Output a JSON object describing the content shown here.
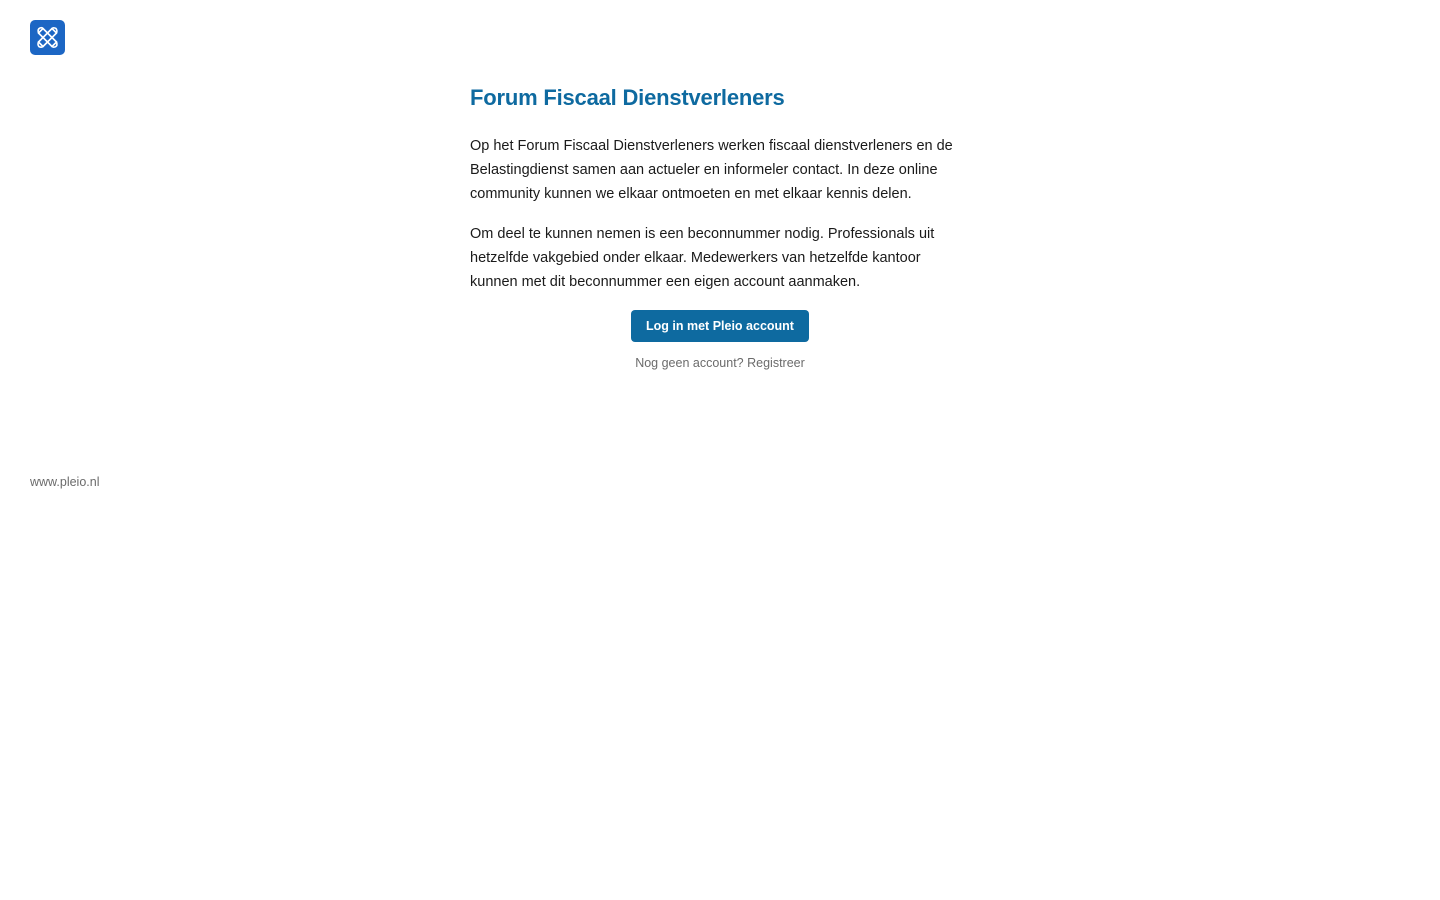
{
  "header": {
    "logo_icon": "pleio-logo-icon",
    "logo_color": "#1c66c4"
  },
  "main": {
    "title": "Forum Fiscaal Dienstverleners",
    "paragraphs": [
      "Op het Forum Fiscaal Dienstverleners werken fiscaal dienstverleners en de Belastingdienst samen aan actueler en informeler contact. In deze online community kunnen we elkaar ontmoeten en met elkaar kennis delen.",
      "Om deel te kunnen nemen is een beconnummer nodig. Professionals uit hetzelfde vakgebied onder elkaar. Medewerkers van hetzelfde kantoor kunnen met dit beconnummer een eigen account aanmaken."
    ],
    "login_button_label": "Log in met Pleio account",
    "register_prompt": "Nog geen account?",
    "register_link_label": "Registreer"
  },
  "footer": {
    "link_label": "www.pleio.nl"
  },
  "colors": {
    "accent": "#0e6aa0",
    "muted_text": "#6b6b6b",
    "body_text": "#1a1a1a"
  }
}
